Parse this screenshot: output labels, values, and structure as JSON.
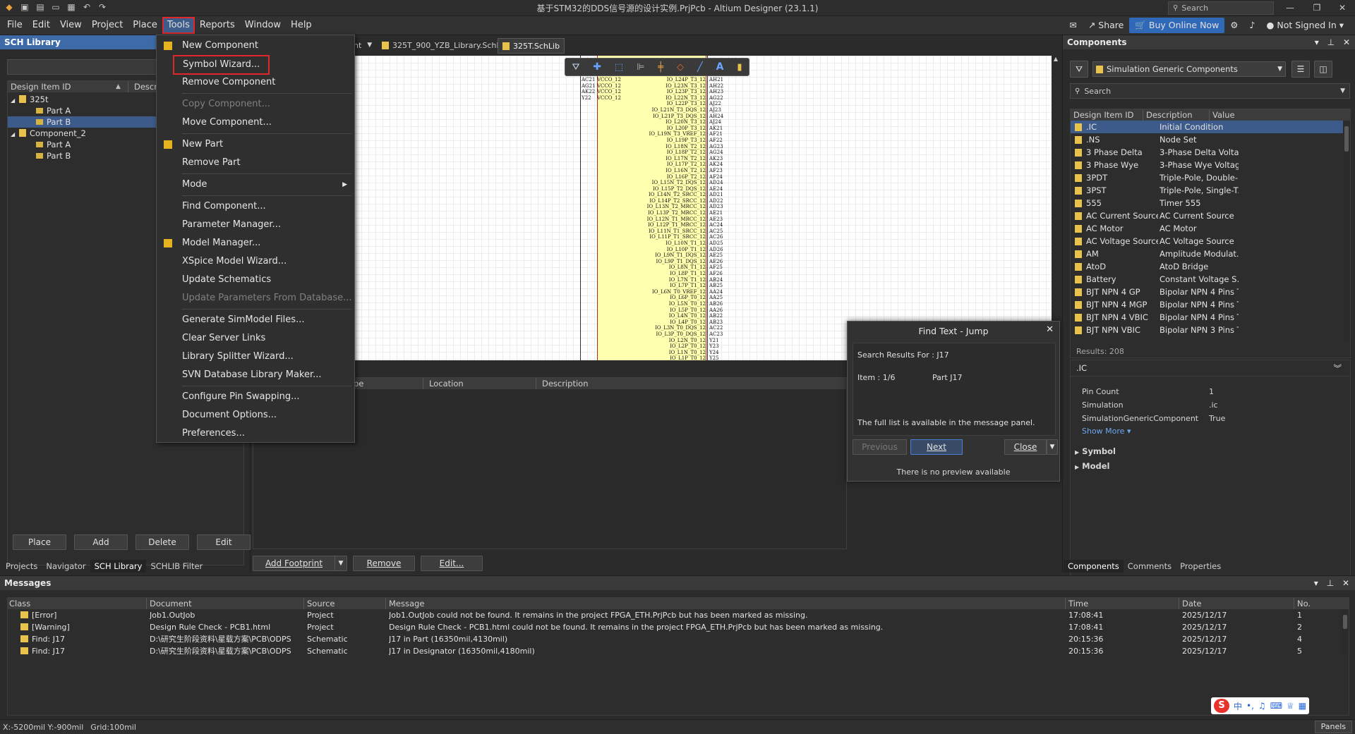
{
  "window": {
    "title": "基于STM32的DDS信号源的设计实例.PrjPcb - Altium Designer (23.1.1)",
    "search_label": "Search"
  },
  "menubar": {
    "items": [
      "File",
      "Edit",
      "View",
      "Project",
      "Place",
      "Tools",
      "Reports",
      "Window",
      "Help"
    ],
    "share": "Share",
    "buy": "Buy Online Now",
    "user": "Not Signed In"
  },
  "tools_menu": {
    "items": [
      {
        "label": "New Component",
        "disabled": false,
        "icon": true
      },
      {
        "label": "Symbol Wizard...",
        "disabled": false,
        "highlight": true
      },
      {
        "label": "Remove Component",
        "disabled": false
      },
      {
        "sep": true
      },
      {
        "label": "Copy Component...",
        "disabled": true
      },
      {
        "label": "Move Component...",
        "disabled": false
      },
      {
        "sep": true
      },
      {
        "label": "New Part",
        "disabled": false,
        "icon": true
      },
      {
        "label": "Remove Part",
        "disabled": false
      },
      {
        "sep": true
      },
      {
        "label": "Mode",
        "disabled": false,
        "submenu": true
      },
      {
        "sep": true
      },
      {
        "label": "Find Component...",
        "disabled": false
      },
      {
        "label": "Parameter Manager...",
        "disabled": false
      },
      {
        "label": "Model Manager...",
        "disabled": false,
        "icon": true
      },
      {
        "label": "XSpice Model Wizard...",
        "disabled": false
      },
      {
        "label": "Update Schematics",
        "disabled": false
      },
      {
        "label": "Update Parameters From Database...",
        "disabled": true
      },
      {
        "sep": true
      },
      {
        "label": "Generate SimModel Files...",
        "disabled": false
      },
      {
        "label": "Clear Server Links",
        "disabled": false
      },
      {
        "label": "Library Splitter Wizard...",
        "disabled": false
      },
      {
        "label": "SVN Database Library Maker...",
        "disabled": false
      },
      {
        "sep": true
      },
      {
        "label": "Configure Pin Swapping...",
        "disabled": false
      },
      {
        "label": "Document Options...",
        "disabled": false
      },
      {
        "label": "Preferences...",
        "disabled": false
      }
    ]
  },
  "sch_library": {
    "title": "SCH Library",
    "col_design_item": "Design Item ID",
    "col_description": "Descrip",
    "tree": [
      {
        "label": "325t",
        "level": 0,
        "type": "comp"
      },
      {
        "label": "Part A",
        "level": 1,
        "type": "part"
      },
      {
        "label": "Part B",
        "level": 1,
        "type": "part",
        "selected": true
      },
      {
        "label": "Component_2",
        "level": 0,
        "type": "comp"
      },
      {
        "label": "Part A",
        "level": 1,
        "type": "part"
      },
      {
        "label": "Part B",
        "level": 1,
        "type": "part"
      }
    ],
    "buttons": [
      "Place",
      "Add",
      "Delete",
      "Edit"
    ],
    "tabs": [
      "Projects",
      "Navigator",
      "SCH Library",
      "SCHLIB Filter"
    ]
  },
  "doc_tabs": [
    "nt",
    "325T_900_YZB_Library.SchLib",
    "325T.SchLib"
  ],
  "schematic": {
    "left_pins": [
      "VCCO_12",
      "VCCO_12",
      "VCCO_12",
      "VCCO_12"
    ],
    "left_pin_nums": [
      "AC21",
      "AG21",
      "AK22",
      "Y22"
    ],
    "right_labels": [
      "IO_L24P_T3_12",
      "IO_L23N_T3_12",
      "IO_L23P_T3_12",
      "IO_L22N_T3_12",
      "IO_L22P_T3_12",
      "IO_L21N_T3_DQS_12",
      "IO_L21P_T3_DQS_12",
      "IO_L20N_T3_12",
      "IO_L20P_T3_12",
      "IO_L19N_T3_VREF_12",
      "IO_L19P_T3_12",
      "IO_L18N_T2_12",
      "IO_L18P_T2_12",
      "IO_L17N_T2_12",
      "IO_L17P_T2_12",
      "IO_L16N_T2_12",
      "IO_L16P_T2_12",
      "IO_L15N_T2_DQS_12",
      "IO_L15P_T2_DQS_12",
      "IO_L14N_T2_SRCC_12",
      "IO_L14P_T2_SRCC_12",
      "IO_L13N_T2_MRCC_12",
      "IO_L13P_T2_MRCC_12",
      "IO_L12N_T1_MRCC_12",
      "IO_L12P_T1_MRCC_12",
      "IO_L11N_T1_SRCC_12",
      "IO_L11P_T1_SRCC_12",
      "IO_L10N_T1_12",
      "IO_L10P_T1_12",
      "IO_L9N_T1_DQS_12",
      "IO_L9P_T1_DQS_12",
      "IO_L8N_T1_12",
      "IO_L8P_T1_12",
      "IO_L7N_T1_12",
      "IO_L7P_T1_12",
      "IO_L6N_T0_VREF_12",
      "IO_L6P_T0_12",
      "IO_L5N_T0_12",
      "IO_L5P_T0_12",
      "IO_L4N_T0_12",
      "IO_L4P_T0_12",
      "IO_L3N_T0_DQS_12",
      "IO_L3P_T0_DQS_12",
      "IO_L2N_T0_12",
      "IO_L2P_T0_12",
      "IO_L1N_T0_12",
      "IO_L1P_T0_12"
    ],
    "right_pin_nums": [
      "AH21",
      "AH22",
      "AH23",
      "AG22",
      "AJ22",
      "AJ23",
      "AH24",
      "AJ24",
      "AK21",
      "AF21",
      "AF22",
      "AG23",
      "AG24",
      "AK23",
      "AK24",
      "AF23",
      "AF24",
      "AD24",
      "AE24",
      "AD21",
      "AD22",
      "AD23",
      "AE21",
      "AE23",
      "AC24",
      "AC25",
      "AC26",
      "AD25",
      "AD26",
      "AE25",
      "AE26",
      "AF25",
      "AF26",
      "AB24",
      "AB25",
      "AA24",
      "AA25",
      "AB26",
      "AA26",
      "AB22",
      "AB23",
      "AC22",
      "AC23",
      "Y21",
      "Y23",
      "Y24",
      "Y25"
    ]
  },
  "footprint_panel": {
    "col_type": "pe",
    "col_location": "Location",
    "col_description": "Description",
    "add_footprint": "Add Footprint",
    "remove": "Remove",
    "edit": "Edit..."
  },
  "find_dialog": {
    "title": "Find Text - Jump",
    "search_results": "Search Results For : J17",
    "item": "Item : 1/6",
    "part": "Part J17",
    "note": "The full list is available in the message panel.",
    "previous": "Previous",
    "next": "Next",
    "close": "Close",
    "no_preview": "There is no preview available"
  },
  "components": {
    "title": "Components",
    "library": "Simulation Generic Components",
    "search_placeholder": "Search",
    "columns": [
      "Design Item ID",
      "Description",
      "Value"
    ],
    "rows": [
      {
        "id": ".IC",
        "desc": "Initial Condition",
        "selected": true
      },
      {
        "id": ".NS",
        "desc": "Node Set"
      },
      {
        "id": "3 Phase Delta",
        "desc": "3-Phase Delta Volta..."
      },
      {
        "id": "3 Phase Wye",
        "desc": "3-Phase Wye Voltag..."
      },
      {
        "id": "3PDT",
        "desc": "Triple-Pole, Double-..."
      },
      {
        "id": "3PST",
        "desc": "Triple-Pole, Single-T..."
      },
      {
        "id": "555",
        "desc": "Timer 555"
      },
      {
        "id": "AC Current Source",
        "desc": "AC Current Source"
      },
      {
        "id": "AC Motor",
        "desc": "AC Motor"
      },
      {
        "id": "AC Voltage Source",
        "desc": "AC Voltage Source"
      },
      {
        "id": "AM",
        "desc": "Amplitude Modulat..."
      },
      {
        "id": "AtoD",
        "desc": "AtoD Bridge"
      },
      {
        "id": "Battery",
        "desc": "Constant Voltage S..."
      },
      {
        "id": "BJT NPN 4 GP",
        "desc": "Bipolar NPN 4 Pins T..."
      },
      {
        "id": "BJT NPN 4 MGP",
        "desc": "Bipolar NPN 4 Pins T..."
      },
      {
        "id": "BJT NPN 4 VBIC",
        "desc": "Bipolar NPN 4 Pins T..."
      },
      {
        "id": "BJT NPN VBIC",
        "desc": "Bipolar NPN 3 Pins T..."
      }
    ],
    "results": "Results: 208",
    "detail_title": ".IC",
    "props": [
      {
        "k": "Pin Count",
        "v": "1"
      },
      {
        "k": "Simulation",
        "v": ".ic"
      },
      {
        "k": "SimulationGenericComponent",
        "v": "True"
      }
    ],
    "show_more": "Show More",
    "sections": [
      "Symbol",
      "Model"
    ],
    "tabs": [
      "Components",
      "Comments",
      "Properties"
    ]
  },
  "messages": {
    "title": "Messages",
    "columns": [
      "Class",
      "Document",
      "Source",
      "Message",
      "Time",
      "Date",
      "No."
    ],
    "rows": [
      {
        "cls": "[Error]",
        "doc": "Job1.OutJob",
        "src": "Project",
        "msg": "Job1.OutJob could not be found. It remains in the project FPGA_ETH.PrjPcb but has been marked as missing.",
        "time": "17:08:41",
        "date": "2025/12/17",
        "no": "1"
      },
      {
        "cls": "[Warning]",
        "doc": "Design Rule Check - PCB1.html",
        "src": "Project",
        "msg": "Design Rule Check - PCB1.html could not be found. It remains in the project FPGA_ETH.PrjPcb but has been marked as missing.",
        "time": "17:08:41",
        "date": "2025/12/17",
        "no": "2"
      },
      {
        "cls": "Find: J17",
        "doc": "D:\\研究生阶段资料\\星载方案\\PCB\\ODPS",
        "src": "Schematic",
        "msg": "J17 in Part (16350mil,4130mil)",
        "time": "20:15:36",
        "date": "2025/12/17",
        "no": "4"
      },
      {
        "cls": "Find: J17",
        "doc": "D:\\研究生阶段资料\\星载方案\\PCB\\ODPS",
        "src": "Schematic",
        "msg": "J17 in Designator (16350mil,4180mil)",
        "time": "20:15:36",
        "date": "2025/12/17",
        "no": "5"
      }
    ]
  },
  "statusbar": {
    "coords": "X:-5200mil Y:-900mil",
    "grid": "Grid:100mil",
    "panels": "Panels"
  }
}
